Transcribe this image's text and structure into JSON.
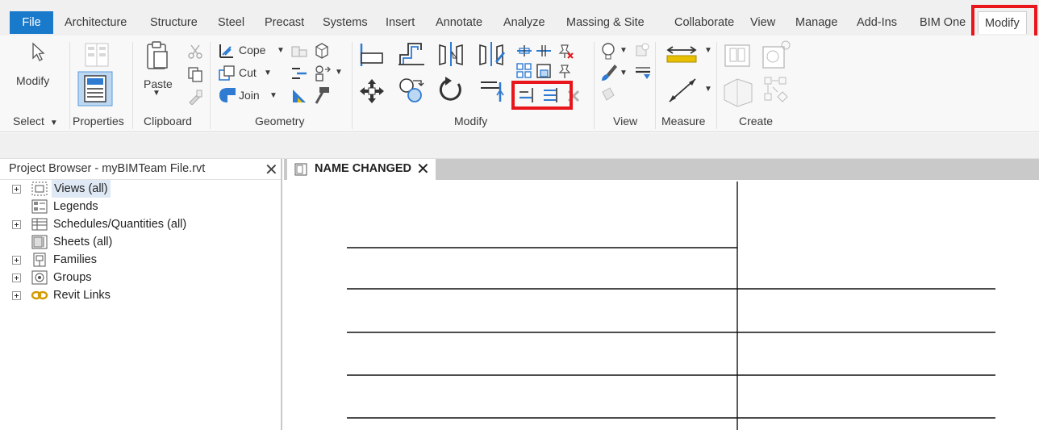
{
  "tabs": [
    {
      "label": "File"
    },
    {
      "label": "Architecture"
    },
    {
      "label": "Structure"
    },
    {
      "label": "Steel"
    },
    {
      "label": "Precast"
    },
    {
      "label": "Systems"
    },
    {
      "label": "Insert"
    },
    {
      "label": "Annotate"
    },
    {
      "label": "Analyze"
    },
    {
      "label": "Massing & Site"
    },
    {
      "label": "Collaborate"
    },
    {
      "label": "View"
    },
    {
      "label": "Manage"
    },
    {
      "label": "Add-Ins"
    },
    {
      "label": "BIM One"
    },
    {
      "label": "Modify"
    }
  ],
  "ribbon": {
    "modify_tool_label": "Modify",
    "paste_label": "Paste",
    "geometry": {
      "cope": "Cope",
      "cut": "Cut",
      "join": "Join"
    },
    "panels": {
      "select": "Select",
      "properties": "Properties",
      "clipboard": "Clipboard",
      "geometry": "Geometry",
      "modify": "Modify",
      "view": "View",
      "measure": "Measure",
      "create": "Create"
    }
  },
  "project_browser": {
    "title": "Project Browser - myBIMTeam File.rvt",
    "items": [
      {
        "label": "Views (all)"
      },
      {
        "label": "Legends"
      },
      {
        "label": "Schedules/Quantities (all)"
      },
      {
        "label": "Sheets (all)"
      },
      {
        "label": "Families"
      },
      {
        "label": "Groups"
      },
      {
        "label": "Revit Links"
      }
    ]
  },
  "view": {
    "tab_title": "NAME CHANGED"
  },
  "colors": {
    "file_tab": "#1979ca",
    "highlight": "#e8151b",
    "icon_blue": "#2e7bd1"
  }
}
